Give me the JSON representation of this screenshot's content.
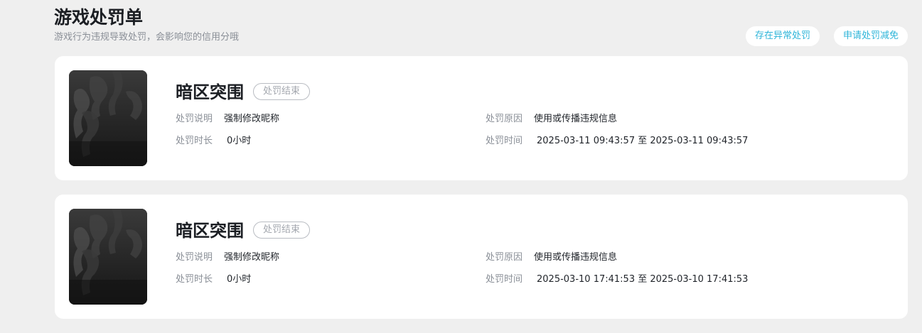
{
  "header": {
    "title": "游戏处罚单",
    "subtitle": "游戏行为违规导致处罚，会影响您的信用分哦"
  },
  "actions": {
    "abnormal_label": "存在异常处罚",
    "reduce_label": "申请处罚减免"
  },
  "labels": {
    "desc": "处罚说明",
    "reason": "处罚原因",
    "duration": "处罚时长",
    "time": "处罚时间"
  },
  "punishments": [
    {
      "game": "暗区突围",
      "status": "处罚结束",
      "desc": "强制修改昵称",
      "reason": "使用或传播违规信息",
      "duration": "0小时",
      "time": "2025-03-11 09:43:57 至 2025-03-11 09:43:57"
    },
    {
      "game": "暗区突围",
      "status": "处罚结束",
      "desc": "强制修改昵称",
      "reason": "使用或传播违规信息",
      "duration": "0小时",
      "time": "2025-03-10 17:41:53 至 2025-03-10 17:41:53"
    }
  ]
}
